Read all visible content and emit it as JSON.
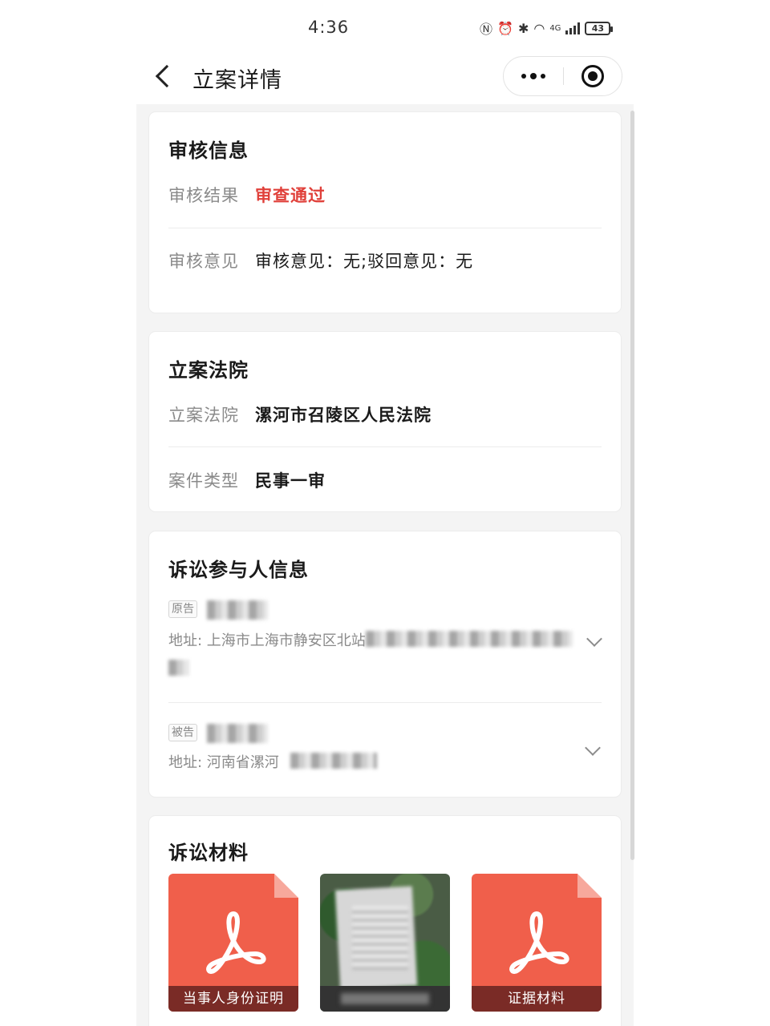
{
  "status_bar": {
    "time": "4:36",
    "network": "4G",
    "battery": "43"
  },
  "nav": {
    "title": "立案详情",
    "back_icon": "chevron-left-icon",
    "more_icon": "more-dots-icon",
    "close_icon": "target-circle-icon"
  },
  "review": {
    "title": "审核信息",
    "result_label": "审核结果",
    "result_value": "审查通过",
    "result_color": "#e0403a",
    "opinion_label": "审核意见",
    "opinion_value": "审核意见：无;驳回意见：无"
  },
  "court": {
    "title": "立案法院",
    "court_label": "立案法院",
    "court_value": "漯河市召陵区人民法院",
    "type_label": "案件类型",
    "type_value": "民事一审"
  },
  "participants": {
    "title": "诉讼参与人信息",
    "items": [
      {
        "role": "原告",
        "address": "地址: 上海市上海市静安区北站"
      },
      {
        "role": "被告",
        "address": "地址: 河南省漯河"
      }
    ]
  },
  "materials": {
    "title": "诉讼材料",
    "files": [
      {
        "label": "当事人身份证明",
        "icon": "pdf-icon"
      },
      {
        "label": "",
        "icon": "photo-thumbnail"
      },
      {
        "label": "证据材料",
        "icon": "pdf-icon"
      }
    ],
    "accent": "#f05f4b"
  }
}
